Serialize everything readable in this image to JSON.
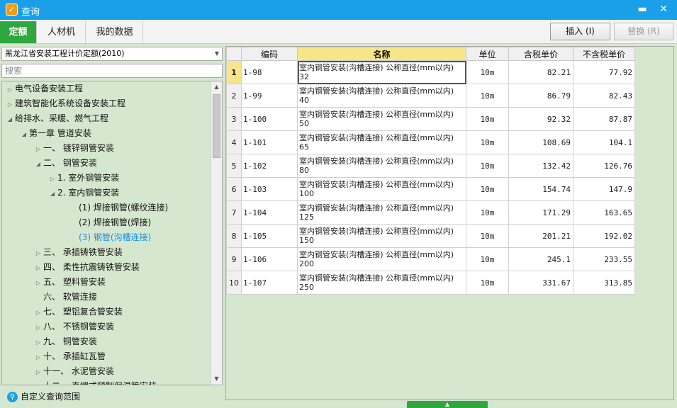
{
  "window": {
    "title": "查询",
    "minimize_icon": "minimize-icon",
    "close_icon": "close-icon"
  },
  "tabs": [
    {
      "label": "定额",
      "active": true
    },
    {
      "label": "人材机",
      "active": false
    },
    {
      "label": "我的数据",
      "active": false
    }
  ],
  "toolbar": {
    "insert_label": "插入 (I)",
    "replace_label": "替换 (R)"
  },
  "left": {
    "quota_select": "黑龙江省安装工程计价定额(2010)",
    "search_placeholder": "搜索",
    "custom_scope_label": "自定义查询范围",
    "tree": [
      {
        "label": "电气设备安装工程",
        "arrow": "▷"
      },
      {
        "label": "建筑智能化系统设备安装工程",
        "arrow": "▷"
      },
      {
        "label": "给排水、采暖、燃气工程",
        "arrow": "◢"
      },
      {
        "label": "第一章 管道安装",
        "arrow": "◢"
      },
      {
        "label": "一、 镀锌钢管安装",
        "arrow": "▷"
      },
      {
        "label": "二、 钢管安装",
        "arrow": "◢"
      },
      {
        "label": "1. 室外钢管安装",
        "arrow": "▷"
      },
      {
        "label": "2. 室内钢管安装",
        "arrow": "◢"
      },
      {
        "label": "(1) 焊接钢管(螺纹连接)",
        "arrow": ""
      },
      {
        "label": "(2) 焊接钢管(焊接)",
        "arrow": ""
      },
      {
        "label": "(3) 钢管(沟槽连接)",
        "arrow": "",
        "selected": true
      },
      {
        "label": "三、 承插铸铁管安装",
        "arrow": "▷"
      },
      {
        "label": "四、 柔性抗震铸铁管安装",
        "arrow": "▷"
      },
      {
        "label": "五、 塑料管安装",
        "arrow": "▷"
      },
      {
        "label": "六、 软管连接",
        "arrow": ""
      },
      {
        "label": "七、 塑铝复合管安装",
        "arrow": "▷"
      },
      {
        "label": "八、 不锈钢管安装",
        "arrow": "▷"
      },
      {
        "label": "九、 铜管安装",
        "arrow": "▷"
      },
      {
        "label": "十、 承插缸瓦管",
        "arrow": "▷"
      },
      {
        "label": "十一、 水泥管安装",
        "arrow": "▷"
      },
      {
        "label": "十二、 直埋式预制保温管安装",
        "arrow": "▷"
      }
    ]
  },
  "grid": {
    "headers": [
      "",
      "编码",
      "名称",
      "单位",
      "含税单价",
      "不含税单价"
    ],
    "rows": [
      {
        "n": "1",
        "code": "1-98",
        "name": "室内钢管安装(沟槽连接) 公称直径(mm以内) 32",
        "unit": "10m",
        "tax": "82.21",
        "notax": "77.92"
      },
      {
        "n": "2",
        "code": "1-99",
        "name": "室内钢管安装(沟槽连接) 公称直径(mm以内) 40",
        "unit": "10m",
        "tax": "86.79",
        "notax": "82.43"
      },
      {
        "n": "3",
        "code": "1-100",
        "name": "室内钢管安装(沟槽连接) 公称直径(mm以内) 50",
        "unit": "10m",
        "tax": "92.32",
        "notax": "87.87"
      },
      {
        "n": "4",
        "code": "1-101",
        "name": "室内钢管安装(沟槽连接) 公称直径(mm以内) 65",
        "unit": "10m",
        "tax": "108.69",
        "notax": "104.1"
      },
      {
        "n": "5",
        "code": "1-102",
        "name": "室内钢管安装(沟槽连接) 公称直径(mm以内) 80",
        "unit": "10m",
        "tax": "132.42",
        "notax": "126.76"
      },
      {
        "n": "6",
        "code": "1-103",
        "name": "室内钢管安装(沟槽连接) 公称直径(mm以内) 100",
        "unit": "10m",
        "tax": "154.74",
        "notax": "147.9"
      },
      {
        "n": "7",
        "code": "1-104",
        "name": "室内钢管安装(沟槽连接) 公称直径(mm以内) 125",
        "unit": "10m",
        "tax": "171.29",
        "notax": "163.65"
      },
      {
        "n": "8",
        "code": "1-105",
        "name": "室内钢管安装(沟槽连接) 公称直径(mm以内) 150",
        "unit": "10m",
        "tax": "201.21",
        "notax": "192.02"
      },
      {
        "n": "9",
        "code": "1-106",
        "name": "室内钢管安装(沟槽连接) 公称直径(mm以内) 200",
        "unit": "10m",
        "tax": "245.1",
        "notax": "233.55"
      },
      {
        "n": "10",
        "code": "1-107",
        "name": "室内钢管安装(沟槽连接) 公称直径(mm以内) 250",
        "unit": "10m",
        "tax": "331.67",
        "notax": "313.85"
      }
    ]
  },
  "colors": {
    "titlebar": "#1aa0e8",
    "accent_green": "#2ea83e",
    "panel_bg": "#d6e7d0",
    "header_highlight": "#f7e58a",
    "selected_text": "#1a8fe0"
  }
}
